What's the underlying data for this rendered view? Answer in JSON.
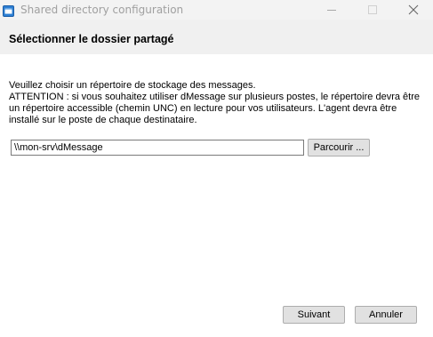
{
  "window": {
    "title": "Shared directory configuration"
  },
  "header": {
    "title": "Sélectionner le dossier partagé"
  },
  "body": {
    "lines": [
      "Veuillez choisir un répertoire de stockage des messages.",
      "ATTENTION : si vous souhaitez utiliser dMessage sur plusieurs postes, le répertoire devra être",
      "un répertoire accessible (chemin UNC) en lecture pour vos utilisateurs. L'agent devra être",
      "installé sur le poste de chaque destinataire."
    ]
  },
  "path_field": {
    "value": "\\\\mon-srv\\dMessage"
  },
  "buttons": {
    "browse": "Parcourir ...",
    "next": "Suivant",
    "cancel": "Annuler"
  },
  "icons": {
    "app": "app-window-icon",
    "minimize": "minimize-icon",
    "maximize": "maximize-icon",
    "close": "close-icon"
  },
  "colors": {
    "titlebar_bg": "#f3f3f3",
    "header_bg": "#f0f0f0",
    "button_bg": "#e1e1e1",
    "title_text": "#a0a0a0"
  }
}
